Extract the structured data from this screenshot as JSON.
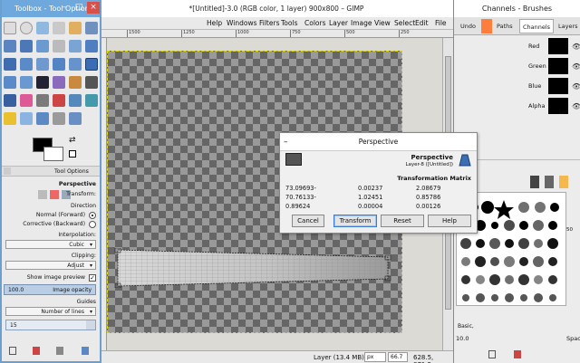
{
  "main_window": {
    "title": "*[Untitled]-3.0 (RGB color, 1 layer) 900x800 – GIMP",
    "menu": [
      "Help",
      "Windows",
      "Filters",
      "Tools",
      "Colors",
      "Layer",
      "Image",
      "View",
      "Select",
      "Edit",
      "File"
    ],
    "ruler_ticks": [
      "1500",
      "1250",
      "1000",
      "750",
      "500",
      "250"
    ],
    "status": {
      "layer_info": "Layer (13.4 MB)",
      "unit": "px",
      "zoom": "66.7 %",
      "coords": "628.5, 871.5"
    }
  },
  "toolbox": {
    "title": "Toolbox - Tool Options",
    "options_tab": "Tool Options",
    "section": "Perspective",
    "transform_label": "Transform:",
    "direction_label": "Direction",
    "direction_normal": "Normal (Forward)",
    "direction_corrective": "Corrective (Backward)",
    "interpolation_label": "Interpolation:",
    "interpolation_value": "Cubic",
    "clipping_label": "Clipping:",
    "clipping_value": "Adjust",
    "show_preview": "Show image preview",
    "opacity_label": "Image opacity",
    "opacity_value": "100.0",
    "guides_label": "Guides",
    "guides_value": "Number of lines",
    "lines_value": "15"
  },
  "dock": {
    "title": "Channels - Brushes",
    "tabs": [
      "Undo",
      "Paths",
      "Channels",
      "Layers"
    ],
    "channels": [
      {
        "name": "Red"
      },
      {
        "name": "Green"
      },
      {
        "name": "Blue"
      },
      {
        "name": "Alpha"
      }
    ],
    "lock_label": "Lo",
    "brush_name": "2. Hardness 050 (51 × 51)",
    "brush_tag": "Basic,",
    "spacing_value": "10.0",
    "spacing_label": "Spaci"
  },
  "dialog": {
    "title": "Perspective",
    "header": "Perspective",
    "subtitle": "Layer-8 ([Untitled])",
    "matrix_title": "Transformation Matrix",
    "matrix": [
      [
        "73.09693-",
        "0.00237",
        "2.08679"
      ],
      [
        "70.76133-",
        "1.02451",
        "0.85786"
      ],
      [
        "0.89624",
        "0.00004",
        "0.00126"
      ]
    ],
    "buttons": {
      "cancel": "Cancel",
      "transform": "Transform",
      "reset": "Reset",
      "help": "Help"
    }
  },
  "colors": {
    "accent": "#6fa8dc",
    "selection": "#dcd800"
  }
}
